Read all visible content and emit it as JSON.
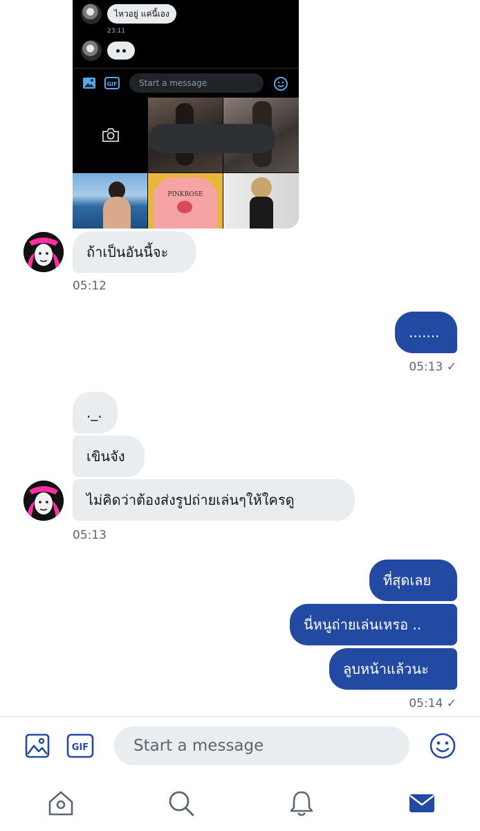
{
  "shared_image": {
    "message_1": "ไหวอยู่ แค่นี้เอง",
    "time": "23:11",
    "input_placeholder": "Start a message",
    "gif_label": "GIF",
    "shirt_text": "PINKROSE"
  },
  "messages": [
    {
      "text": "ถ้าเป็นอันนี้จะ",
      "side": "received"
    },
    {
      "time": "05:12"
    },
    {
      "text": ".......",
      "side": "sent"
    },
    {
      "time": "05:13 ✓"
    },
    {
      "text": "._.",
      "side": "received"
    },
    {
      "text": "เขินจัง",
      "side": "received"
    },
    {
      "text": "ไม่คิดว่าต้องส่งรูปถ่ายเล่นๆให้ใครดู",
      "side": "received"
    },
    {
      "time": "05:13"
    },
    {
      "text": "ที่สุดเลย",
      "side": "sent"
    },
    {
      "text": "นี่หนูถ่ายเล่นเหรอ ..",
      "side": "sent"
    },
    {
      "text": "ลูบหน้าแล้วนะ",
      "side": "sent"
    },
    {
      "time": "05:14 ✓"
    }
  ],
  "compose": {
    "gif_label": "GIF",
    "placeholder": "Start a message"
  },
  "tabs": [
    "home-icon",
    "search-icon",
    "bell-icon",
    "mail-icon"
  ],
  "colors": {
    "sent_bubble": "#234aa3",
    "received_bubble": "#e9edf0",
    "accent": "#234aa3"
  }
}
